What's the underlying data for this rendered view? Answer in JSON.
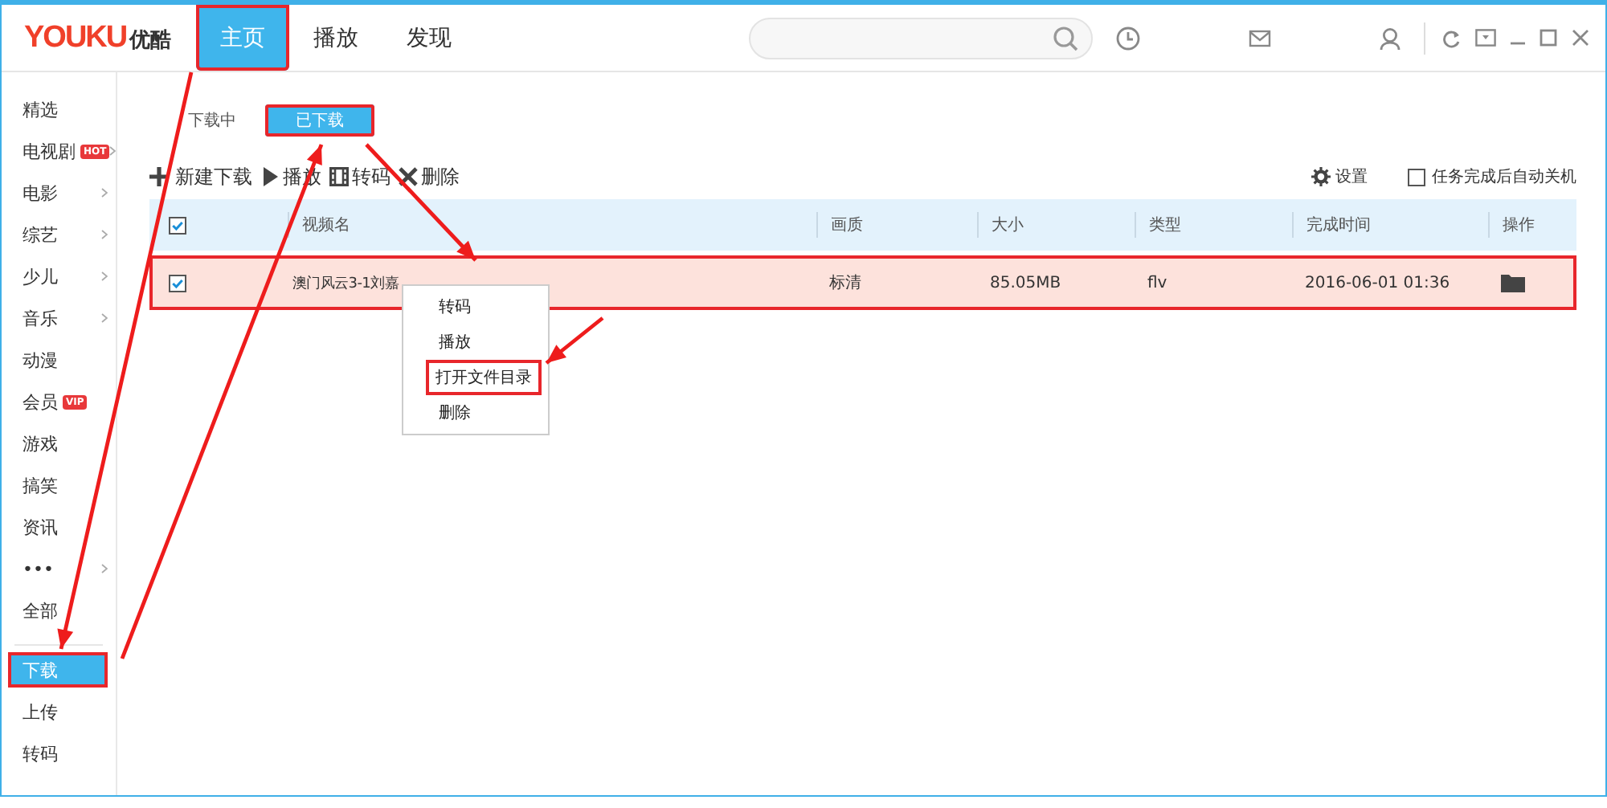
{
  "app": {
    "logo_text": "YOUKU",
    "logo_cn": "优酷"
  },
  "nav_tabs": [
    {
      "label": "主页",
      "selected": true,
      "marked": true
    },
    {
      "label": "播放",
      "selected": false,
      "marked": false
    },
    {
      "label": "发现",
      "selected": false,
      "marked": false
    }
  ],
  "sidebar": {
    "channels": [
      {
        "label": "精选",
        "has_submenu": false
      },
      {
        "label": "电视剧",
        "badge": "HOT",
        "has_submenu": true
      },
      {
        "label": "电影",
        "has_submenu": true
      },
      {
        "label": "综艺",
        "has_submenu": true
      },
      {
        "label": "少儿",
        "has_submenu": true
      },
      {
        "label": "音乐",
        "has_submenu": true
      },
      {
        "label": "动漫",
        "has_submenu": false
      },
      {
        "label": "会员",
        "badge": "VIP",
        "has_submenu": false
      },
      {
        "label": "游戏",
        "has_submenu": false
      },
      {
        "label": "搞笑",
        "has_submenu": false
      },
      {
        "label": "资讯",
        "has_submenu": false
      },
      {
        "label": "•••",
        "has_submenu": true
      },
      {
        "label": "全部",
        "has_submenu": false
      }
    ],
    "tools": [
      {
        "label": "下载",
        "selected": true,
        "marked": true
      },
      {
        "label": "上传",
        "selected": false,
        "marked": false
      },
      {
        "label": "转码",
        "selected": false,
        "marked": false
      }
    ]
  },
  "download_tabs": [
    {
      "label": "下载中",
      "selected": false,
      "marked": false
    },
    {
      "label": "已下载",
      "selected": true,
      "marked": true
    }
  ],
  "toolbar": {
    "actions": [
      {
        "kind": "plus",
        "label": "新建下载"
      },
      {
        "kind": "play",
        "label": "播放"
      },
      {
        "kind": "film",
        "label": "转码"
      },
      {
        "kind": "cross",
        "label": "删除"
      }
    ],
    "settings": "设置",
    "auto_shutdown": {
      "label": "任务完成后自动关机",
      "checked": false
    }
  },
  "table": {
    "all_checked": true,
    "columns": [
      "视频名",
      "画质",
      "大小",
      "类型",
      "完成时间",
      "操作"
    ],
    "rows": [
      {
        "checked": true,
        "marked": true,
        "cells": [
          "澳门风云3-1刘嘉",
          "标清",
          "85.05MB",
          "flv",
          "2016-06-01 01:36"
        ]
      }
    ]
  },
  "context_menu": {
    "items": [
      {
        "label": "转码",
        "marked": false
      },
      {
        "label": "播放",
        "marked": false
      },
      {
        "label": "打开文件目录",
        "marked": true
      },
      {
        "label": "删除",
        "marked": false
      }
    ]
  }
}
